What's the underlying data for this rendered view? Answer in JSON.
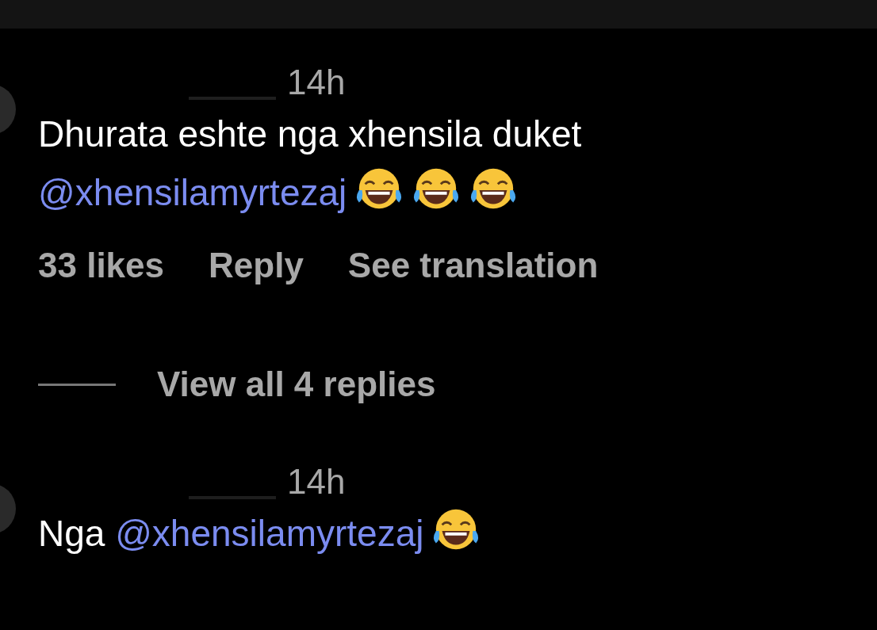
{
  "comments": [
    {
      "time": "14h",
      "text_parts": [
        {
          "kind": "plain",
          "text": "Dhurata eshte nga xhensila duket"
        },
        {
          "kind": "mention",
          "text": "@xhensilamyrtezaj"
        }
      ],
      "emojis": [
        {
          "kind": "laughing-tears"
        },
        {
          "kind": "laughing-tears"
        },
        {
          "kind": "laughing-tears"
        }
      ],
      "actions": [
        "33 likes",
        "Reply",
        "See translation"
      ],
      "replies_link": "View all 4 replies"
    },
    {
      "time": "14h",
      "text_parts": [
        {
          "kind": "plain",
          "text": "Nga"
        },
        {
          "kind": "mention",
          "text": "@xhensilamyrtezaj"
        }
      ],
      "emojis": [
        {
          "kind": "laughing-tears"
        }
      ]
    }
  ]
}
